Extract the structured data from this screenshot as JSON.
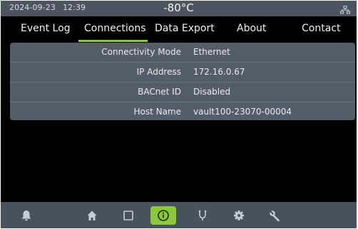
{
  "status": {
    "date": "2024-09-23",
    "time": "12:39",
    "temperature": "-80°C",
    "network_icon": "network-icon"
  },
  "tabs": [
    {
      "label": "Event Log"
    },
    {
      "label": "Connections",
      "active": true
    },
    {
      "label": "Data Export"
    },
    {
      "label": "About"
    },
    {
      "label": "Contact"
    }
  ],
  "connections": {
    "rows": [
      {
        "label": "Connectivity Mode",
        "value": "Ethernet"
      },
      {
        "label": "IP Address",
        "value": "172.16.0.67"
      },
      {
        "label": "BACnet ID",
        "value": "Disabled"
      },
      {
        "label": "Host Name",
        "value": "vault100-23070-00004"
      }
    ]
  },
  "bottom_nav": {
    "items": [
      "alarm-bell-icon",
      "home-icon",
      "square-icon",
      "info-icon",
      "probe-icon",
      "gear-icon",
      "wrench-icon"
    ],
    "active": "info-icon"
  },
  "colors": {
    "accent": "#8dc63f",
    "status_bar": "#4a5560",
    "panel": "#545e68",
    "background": "#000000"
  }
}
